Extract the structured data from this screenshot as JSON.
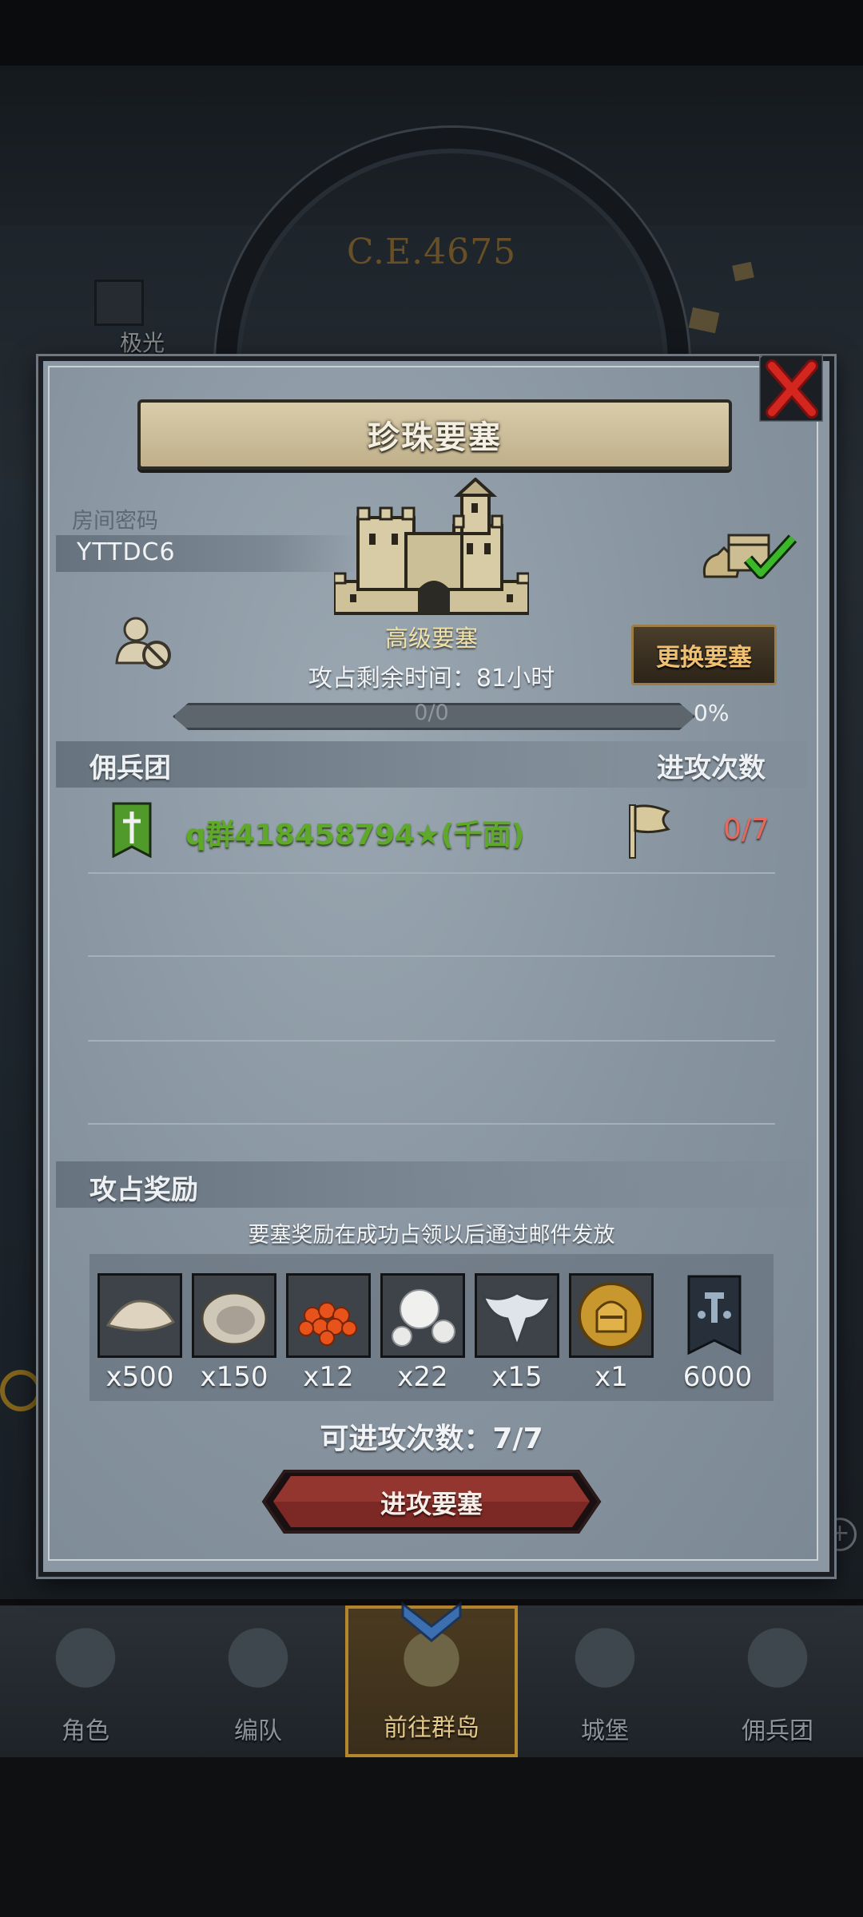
{
  "background": {
    "era_label": "C.E.4675",
    "side_label": "极光"
  },
  "dialog": {
    "title": "珍珠要塞",
    "room": {
      "label": "房间密码",
      "code": "YTTDC6"
    },
    "fortress_type": "高级要塞",
    "time_left_text": "攻占剩余时间：81小时",
    "change_button": "更换要塞",
    "progress": {
      "text": "0/0",
      "percent_text": "0%",
      "fraction": 0
    },
    "mercenary_header": "佣兵团",
    "attack_count_header": "进攻次数",
    "teams": [
      {
        "name": "q群418458794★(千面)",
        "attempts": "0/7"
      }
    ],
    "rewards_header": "攻占奖励",
    "rewards_note": "要塞奖励在成功占领以后通过邮件发放",
    "rewards": [
      {
        "icon": "salt-pile-icon",
        "qty": "x500"
      },
      {
        "icon": "oyster-icon",
        "qty": "x150"
      },
      {
        "icon": "fish-roe-icon",
        "qty": "x12"
      },
      {
        "icon": "pearls-icon",
        "qty": "x22"
      },
      {
        "icon": "silver-emblem-icon",
        "qty": "x15"
      },
      {
        "icon": "gold-helmet-medal-icon",
        "qty": "x1"
      },
      {
        "icon": "mercenary-banner-icon",
        "qty": "6000"
      }
    ],
    "available_attacks": "可进攻次数：7/7",
    "attack_button": "进攻要塞"
  },
  "nav": {
    "items": [
      {
        "label": "角色",
        "active": false
      },
      {
        "label": "编队",
        "active": false
      },
      {
        "label": "前往群岛",
        "active": true
      },
      {
        "label": "城堡",
        "active": false
      },
      {
        "label": "佣兵团",
        "active": false
      }
    ]
  },
  "colors": {
    "team_name": "#5fa92a",
    "attempts": "#e36a5e",
    "change_button_text": "#f0c071",
    "nav_active_border": "#b4862e"
  }
}
